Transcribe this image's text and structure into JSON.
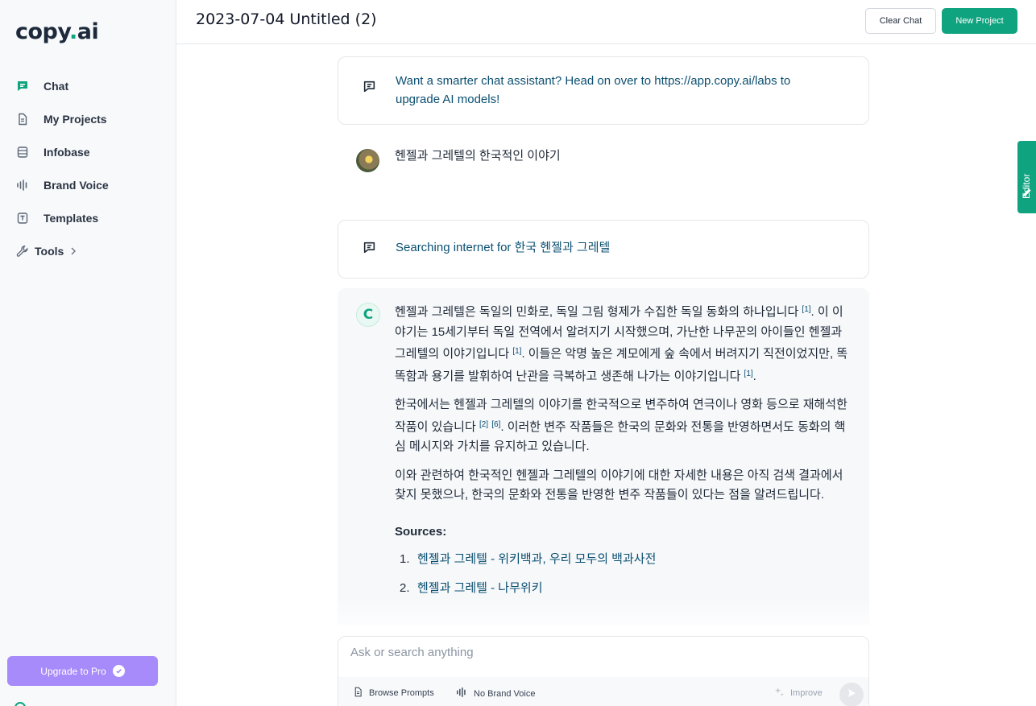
{
  "app": {
    "logo_main": "copy",
    "logo_dot": ".",
    "logo_tail": "ai"
  },
  "sidebar": {
    "items": [
      {
        "label": "Chat",
        "icon": "chat-icon"
      },
      {
        "label": "My Projects",
        "icon": "document-icon"
      },
      {
        "label": "Infobase",
        "icon": "database-icon"
      },
      {
        "label": "Brand Voice",
        "icon": "voice-bars-icon"
      },
      {
        "label": "Templates",
        "icon": "template-icon"
      },
      {
        "label": "Tools",
        "icon": "wrench-icon"
      }
    ],
    "upgrade_label": "Upgrade to Pro"
  },
  "header": {
    "title": "2023-07-04 Untitled (2)",
    "clear_label": "Clear Chat",
    "new_label": "New Project"
  },
  "editor_tab": {
    "label": "Editor"
  },
  "chat": {
    "notice": "Want a smarter chat assistant? Head on over to https://app.copy.ai/labs to upgrade AI models!",
    "user_message": "헨젤과 그레텔의 한국적인 이야기",
    "searching_prefix": "Searching internet for ",
    "searching_query": "한국 헨젤과 그레텔",
    "ai_avatar_letter": "C",
    "p1": {
      "a": "헨젤과 그레텔은 독일의 민화로, 독일 그림 형제가 수집한 독일 동화의 하나입니다 ",
      "r1": "[1]",
      "b": ". 이 이야기는 15세기부터 독일 전역에서 알려지기 시작했으며, 가난한 나무꾼의 아이들인 헨젤과 그레텔의 이야기입니다 ",
      "r2": "[1]",
      "c": ". 이들은 악명 높은 계모에게 숲 속에서 버려지기 직전이었지만, 똑똑함과 용기를 발휘하여 난관을 극복하고 생존해 나가는 이야기입니다 ",
      "r3": "[1]",
      "d": "."
    },
    "p2": {
      "a": "한국에서는 헨젤과 그레텔의 이야기를 한국적으로 변주하여 연극이나 영화 등으로 재해석한 작품이 있습니다 ",
      "r1": "[2]",
      "r2": "[6]",
      "b": ". 이러한 변주 작품들은 한국의 문화와 전통을 반영하면서도 동화의 핵심 메시지와 가치를 유지하고 있습니다."
    },
    "p3": "이와 관련하여 한국적인 헨젤과 그레텔의 이야기에 대한 자세한 내용은 아직 검색 결과에서 찾지 못했으나, 한국의 문화와 전통을 반영한 변주 작품들이 있다는 점을 알려드립니다.",
    "sources_heading": "Sources:",
    "sources": [
      {
        "num": "1.",
        "title": "헨젤과 그레텔 - 위키백과, 우리 모두의 백과사전"
      },
      {
        "num": "2.",
        "title": "헨젤과 그레텔 - 나무위키"
      }
    ]
  },
  "input": {
    "placeholder": "Ask or search anything",
    "browse_label": "Browse Prompts",
    "brand_voice_label": "No Brand Voice",
    "improve_label": "Improve"
  },
  "colors": {
    "accent": "#10a37f",
    "upgrade": "#a78bfa",
    "link": "#0b4f71"
  }
}
